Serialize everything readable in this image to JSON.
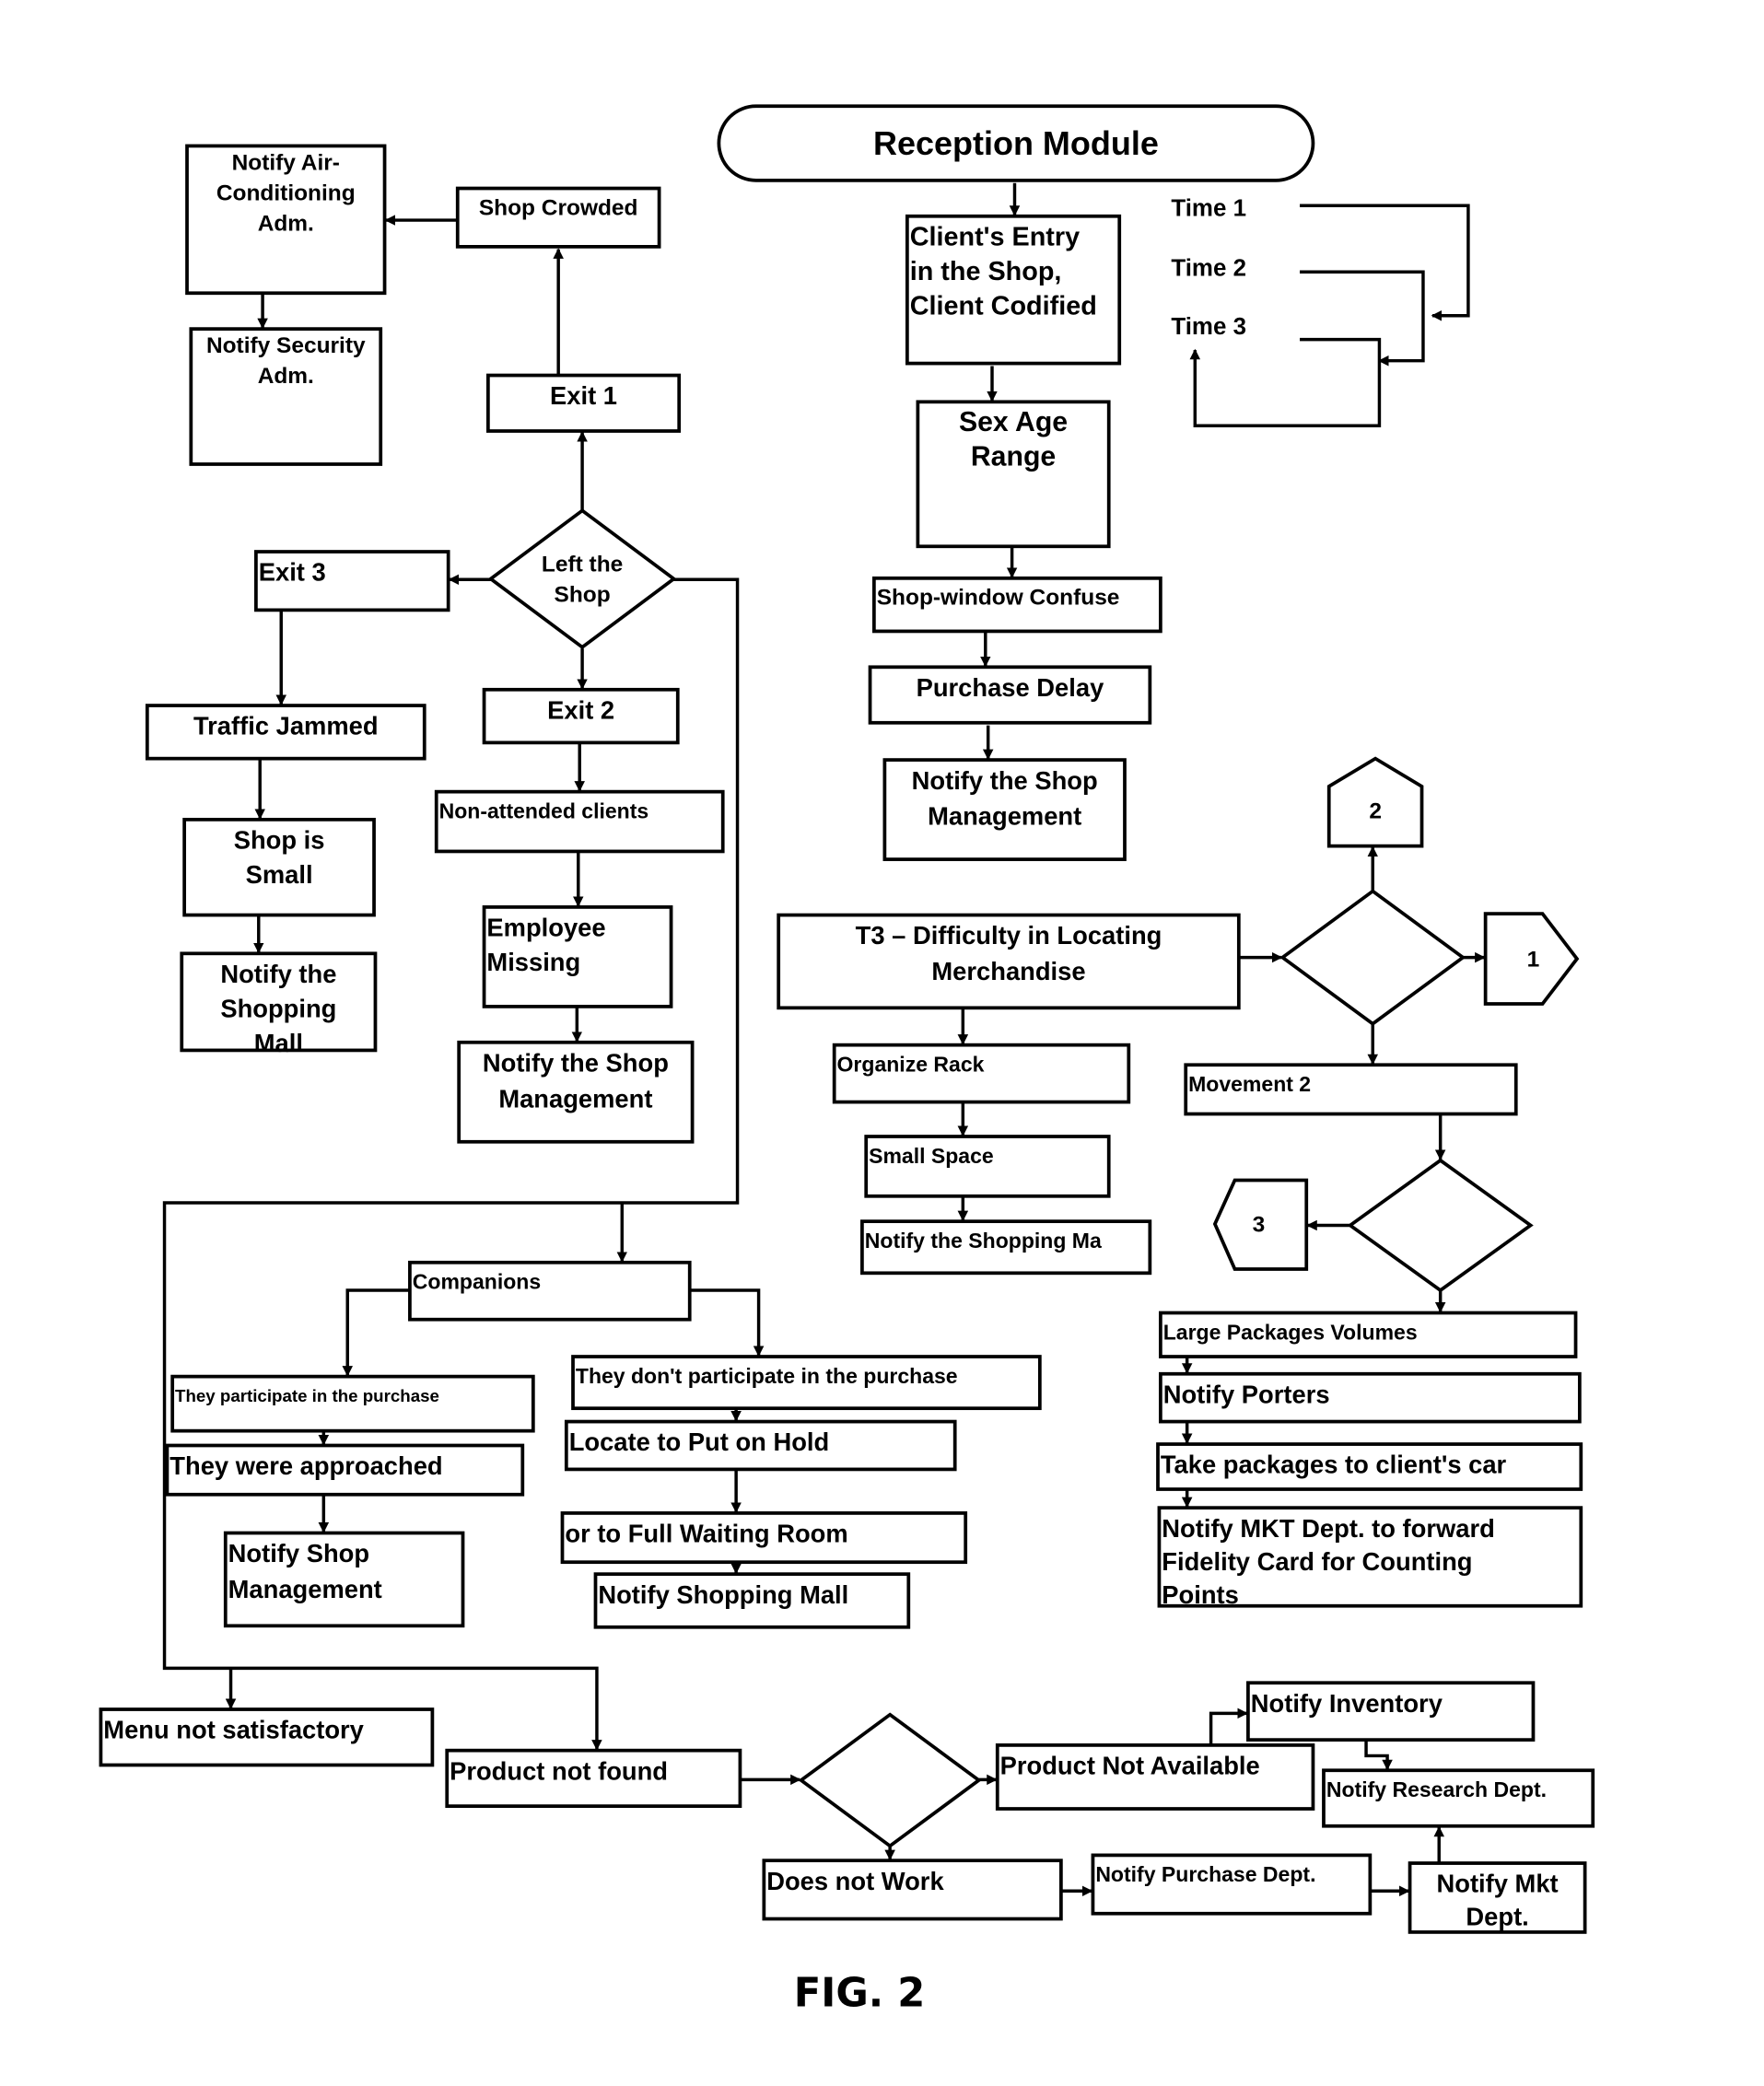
{
  "figure": {
    "caption": "FIG. 2",
    "ink_color": "#000000",
    "paper_color": "#ffffff"
  },
  "nodes": {
    "reception_module": "Reception Module",
    "clients_entry": [
      "Client's Entry",
      "in the Shop,",
      "Client Codified"
    ],
    "time_1": "Time 1",
    "time_2": "Time 2",
    "time_3": "Time 3",
    "sex_age_range": [
      "Sex Age",
      "Range"
    ],
    "shop_window_confuse": "Shop-window Confuse",
    "purchase_delay": "Purchase Delay",
    "notify_shop_management_1": [
      "Notify the Shop",
      "Management"
    ],
    "notify_air_conditioning": [
      "Notify Air-",
      "Conditioning",
      "Adm."
    ],
    "shop_crowded": "Shop Crowded",
    "notify_security": [
      "Notify Security",
      "Adm."
    ],
    "exit_1": "Exit 1",
    "left_the_shop": [
      "Left the",
      "Shop"
    ],
    "exit_3": "Exit 3",
    "exit_2": "Exit 2",
    "traffic_jammed": "Traffic Jammed",
    "shop_is_small": [
      "Shop is",
      "Small"
    ],
    "notify_shopping_mall_1": [
      "Notify the",
      "Shopping",
      "Mall"
    ],
    "non_attended_clients": "Non-attended clients",
    "employee_missing": [
      "Employee",
      "Missing"
    ],
    "notify_shop_management_2": [
      "Notify the Shop",
      "Management"
    ],
    "t3_difficulty": [
      "T3 – Difficulty in Locating",
      "Merchandise"
    ],
    "organize_rack": "Organize Rack",
    "small_space": "Small Space",
    "notify_shopping_mall_2": "Notify the Shopping Ma",
    "connector_1": "1",
    "connector_2": "2",
    "connector_3": "3",
    "movement_2": "Movement 2",
    "large_packages": "Large Packages Volumes",
    "notify_porters": "Notify Porters",
    "take_packages": "Take packages to client's car",
    "notify_mkt_fidelity": [
      "Notify MKT Dept. to forward",
      "Fidelity Card for Counting",
      "Points"
    ],
    "companions": "Companions",
    "they_participate": "They participate in the purchase",
    "they_dont_participate": "They don't participate in the purchase",
    "they_were_approached": "They were approached",
    "locate_to_put_on_hold": "Locate to Put on Hold",
    "or_full_waiting_room": "or to Full Waiting Room",
    "notify_shop_management_3": [
      "Notify Shop",
      "Management"
    ],
    "notify_shopping_mall_3": "Notify Shopping Mall",
    "menu_not_satisfactory": "Menu not satisfactory",
    "product_not_found": "Product not found",
    "product_not_available": "Product Not Available",
    "does_not_work": "Does not Work",
    "notify_inventory": "Notify Inventory",
    "notify_research_dept": "Notify Research Dept.",
    "notify_purchase_dept": "Notify Purchase Dept.",
    "notify_mkt_dept": [
      "Notify Mkt",
      "Dept."
    ]
  }
}
